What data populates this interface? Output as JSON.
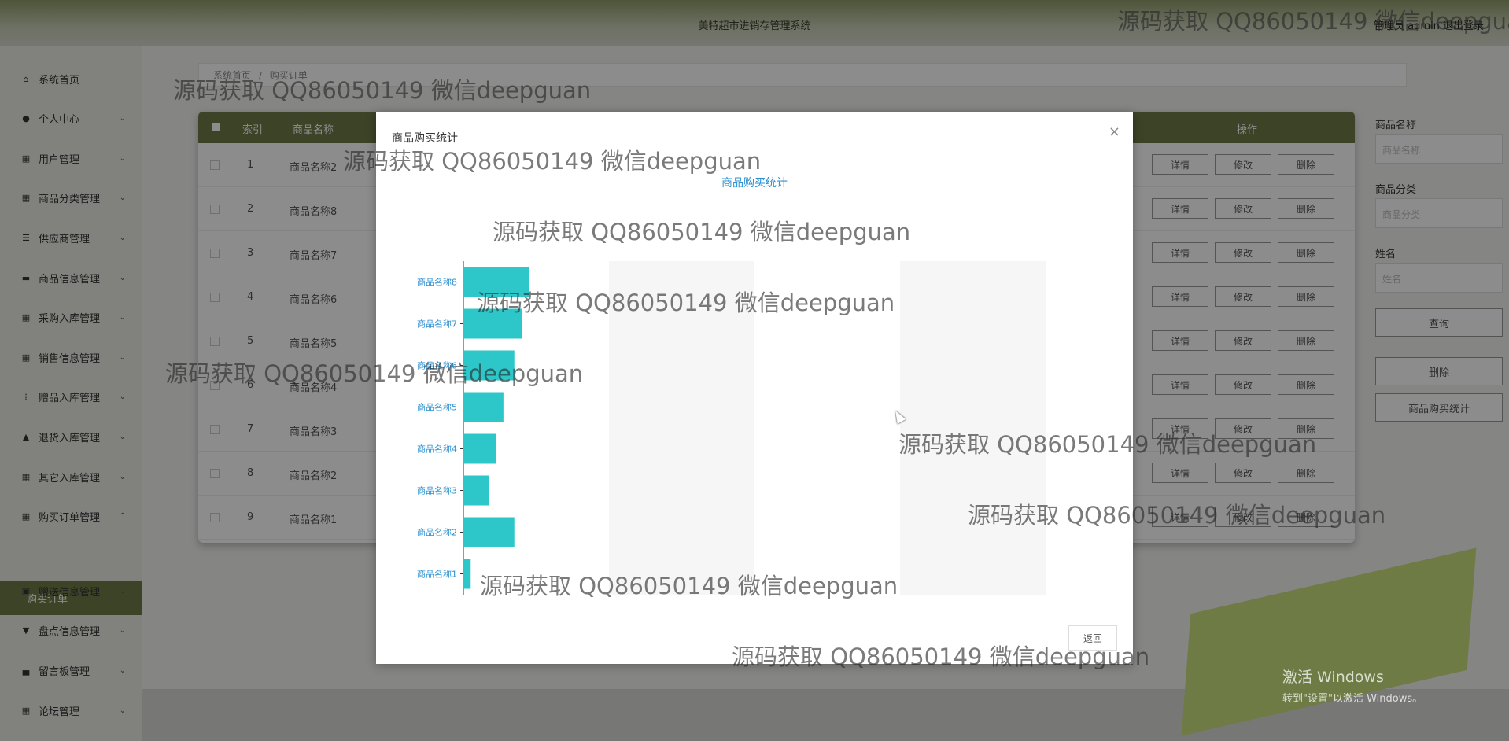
{
  "header": {
    "title": "美特超市进销存管理系统",
    "user": "管理员 admin  退出登录"
  },
  "sidebar": {
    "items": [
      {
        "label": "系统首页",
        "icon": "home-icon",
        "glyph": "⌂",
        "arrow": ""
      },
      {
        "label": "个人中心",
        "icon": "user-icon",
        "glyph": "●",
        "arrow": "⌄"
      },
      {
        "label": "用户管理",
        "icon": "grid-icon",
        "glyph": "▦",
        "arrow": "⌄"
      },
      {
        "label": "商品分类管理",
        "icon": "grid-icon",
        "glyph": "▦",
        "arrow": "⌄"
      },
      {
        "label": "供应商管理",
        "icon": "list-icon",
        "glyph": "☰",
        "arrow": "⌄"
      },
      {
        "label": "商品信息管理",
        "icon": "comment-icon",
        "glyph": "▬",
        "arrow": "⌄"
      },
      {
        "label": "采购入库管理",
        "icon": "grid-icon",
        "glyph": "▦",
        "arrow": "⌄"
      },
      {
        "label": "销售信息管理",
        "icon": "grid-icon",
        "glyph": "▦",
        "arrow": "⌄"
      },
      {
        "label": "赠品入库管理",
        "icon": "apps-icon",
        "glyph": "⁞",
        "arrow": "⌄"
      },
      {
        "label": "退货入库管理",
        "icon": "thumb-icon",
        "glyph": "▲",
        "arrow": "⌄"
      },
      {
        "label": "其它入库管理",
        "icon": "grid-icon",
        "glyph": "▦",
        "arrow": "⌄"
      },
      {
        "label": "购买订单管理",
        "icon": "grid-icon",
        "glyph": "▦",
        "arrow": "⌃"
      },
      {
        "label": "赠送信息管理",
        "icon": "clipboard-icon",
        "glyph": "▣",
        "arrow": "⌄"
      },
      {
        "label": "盘点信息管理",
        "icon": "cup-icon",
        "glyph": "▼",
        "arrow": "⌄"
      },
      {
        "label": "留言板管理",
        "icon": "print-icon",
        "glyph": "▄",
        "arrow": "⌄"
      },
      {
        "label": "论坛管理",
        "icon": "grid-icon",
        "glyph": "▦",
        "arrow": "⌄"
      }
    ],
    "active_sub": "购买订单"
  },
  "breadcrumb": {
    "home": "系统首页",
    "sep": "/",
    "current": "购买订单"
  },
  "table": {
    "headers": [
      "■",
      "索引",
      "商品名称",
      "操作"
    ],
    "rows": [
      {
        "index": "1",
        "name": "商品名称2"
      },
      {
        "index": "2",
        "name": "商品名称8"
      },
      {
        "index": "3",
        "name": "商品名称7"
      },
      {
        "index": "4",
        "name": "商品名称6"
      },
      {
        "index": "5",
        "name": "商品名称5"
      },
      {
        "index": "6",
        "name": "商品名称4"
      },
      {
        "index": "7",
        "name": "商品名称3"
      },
      {
        "index": "8",
        "name": "商品名称2"
      },
      {
        "index": "9",
        "name": "商品名称1"
      }
    ],
    "actions": [
      "详情",
      "修改",
      "删除"
    ]
  },
  "filter": {
    "name_label": "商品名称",
    "name_placeholder": "商品名称",
    "category_label": "商品分类",
    "category_placeholder": "商品分类",
    "person_label": "姓名",
    "person_placeholder": "姓名",
    "query": "查询",
    "delete": "删除",
    "stats": "商品购买统计"
  },
  "dialog": {
    "title": "商品购买统计",
    "close": "×",
    "back": "返回"
  },
  "chart_data": {
    "type": "bar",
    "orientation": "horizontal",
    "title": "商品购买统计",
    "categories": [
      "商品名称8",
      "商品名称7",
      "商品名称6",
      "商品名称5",
      "商品名称4",
      "商品名称3",
      "商品名称2",
      "商品名称1"
    ],
    "values": [
      0.9,
      0.8,
      0.7,
      0.55,
      0.45,
      0.35,
      0.7,
      0.1
    ],
    "xlim": [
      0,
      8
    ],
    "xticks": [
      0,
      2,
      4,
      6,
      8
    ],
    "bar_color": "#2ec7c9",
    "label_color": "#2b8fd0"
  },
  "watermark": "源码获取 QQ86050149 微信deepguan",
  "windows": {
    "line1": "激活 Windows",
    "line2": "转到\"设置\"以激活 Windows。"
  },
  "colors": {
    "accent": "#6e7b45",
    "bar": "#2ec7c9"
  }
}
